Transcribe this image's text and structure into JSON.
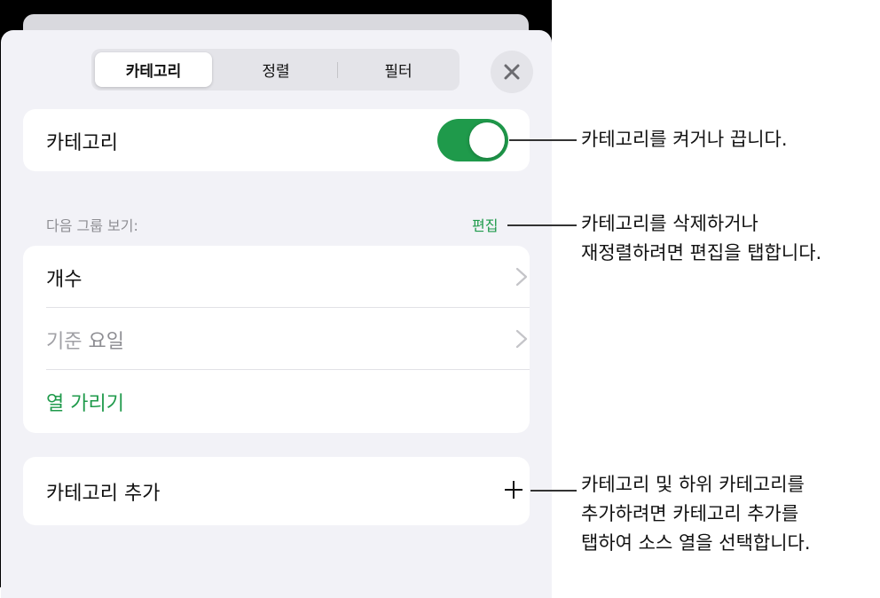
{
  "tabs": [
    "카테고리",
    "정렬",
    "필터"
  ],
  "categories_row": {
    "label": "카테고리",
    "toggle_on": true
  },
  "group_section": {
    "heading": "다음 그룹 보기:",
    "edit_label": "편집",
    "items": [
      {
        "label": "개수"
      },
      {
        "label_part1": "기준",
        "label_part2": "요일"
      },
      {
        "label": "열 가리기"
      }
    ]
  },
  "add_category": {
    "label": "카테고리 추가"
  },
  "callouts": {
    "toggle": [
      "카테고리를 켜거나 끕니다."
    ],
    "edit": [
      "카테고리를 삭제하거나",
      "재정렬하려면 편집을 탭합니다."
    ],
    "add": [
      "카테고리 및 하위 카테고리를",
      "추가하려면 카테고리 추가를",
      "탭하여 소스 열을 선택합니다."
    ]
  },
  "colors": {
    "accent": "#1f9a4b",
    "sheet_bg": "#f2f2f7",
    "card_bg": "#ffffff",
    "muted_text": "#a0a0a5"
  },
  "icons": {
    "close": "close-icon",
    "chevron": "chevron-right-icon",
    "plus": "plus-icon"
  }
}
